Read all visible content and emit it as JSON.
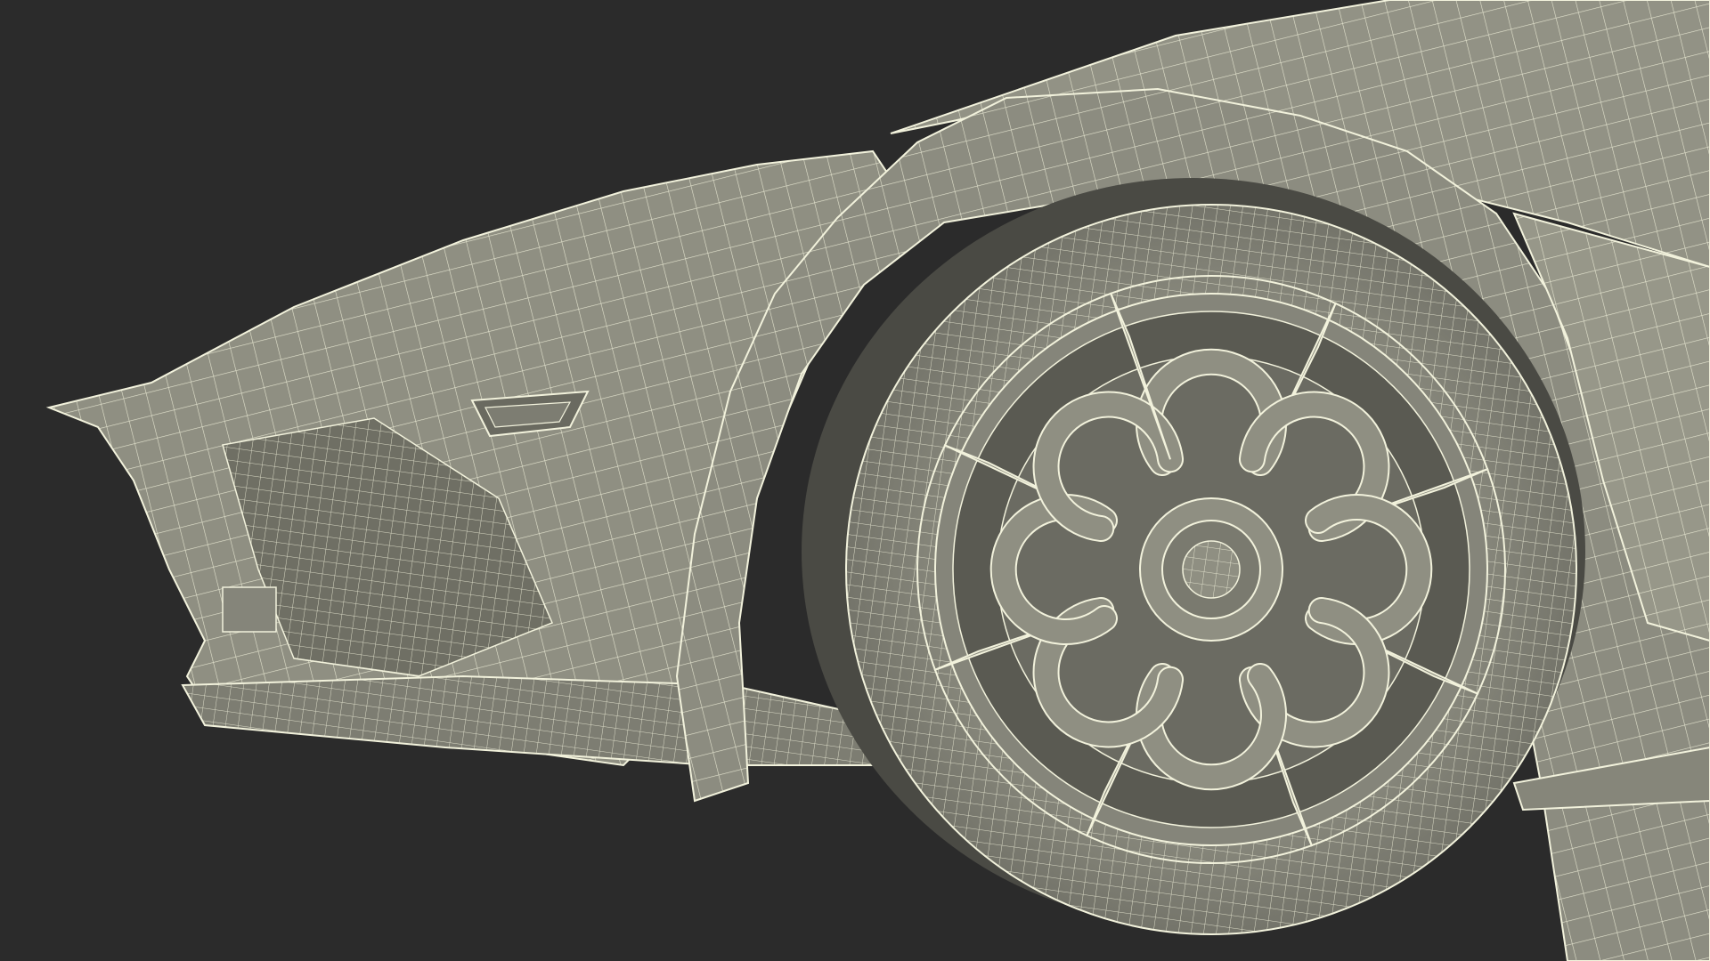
{
  "scene": {
    "subject": "3d-wireframe-car-front-wheel",
    "background_color": "#2b2b2b",
    "surface_color": "#8f8f82",
    "surface_light_color": "#a3a396",
    "surface_dark_color": "#6f6f64",
    "wire_color": "#f2f2dc"
  }
}
